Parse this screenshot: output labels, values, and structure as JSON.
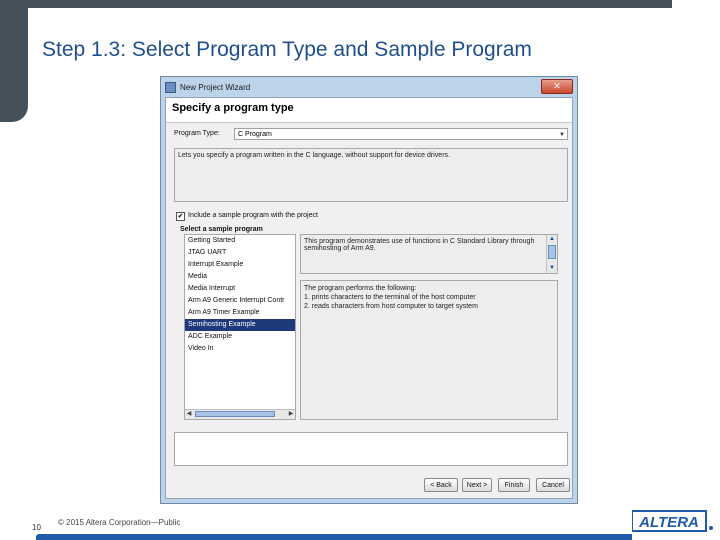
{
  "slide": {
    "title": "Step 1.3: Select Program Type and Sample Program",
    "page_number": "10",
    "copyright": "© 2015 Altera Corporation—Public",
    "logo_text": "ALTERA."
  },
  "window": {
    "title": "New Project Wizard",
    "close_label": "✕",
    "header": "Specify a program type",
    "program_type_label": "Program Type:",
    "program_type_value": "C Program",
    "description": "Lets you specify a program written in the C language, without support for device drivers.",
    "include_sample_label": "Include a sample program with the project",
    "include_sample_checked": "✔",
    "select_sample_label": "Select a sample program",
    "samples": [
      "Getting Started",
      "JTAG UART",
      "Interrupt Example",
      "Media",
      "Media Interrupt",
      "Arm A9 Generic Interrupt Contr",
      "Arm A9 Timer Example",
      "Semihosting Example",
      "ADC Example",
      "Video In"
    ],
    "info_top": "This program demonstrates use of functions in C Standard Library through semihosting of Arm A9.",
    "info_body_line1": "The program performs the following:",
    "info_body_line2": "1. prints characters to the terminal of the host computer",
    "info_body_line3": "2. reads characters from host computer to target system",
    "buttons": {
      "back": "< Back",
      "next": "Next >",
      "finish": "Finish",
      "cancel": "Cancel"
    }
  }
}
